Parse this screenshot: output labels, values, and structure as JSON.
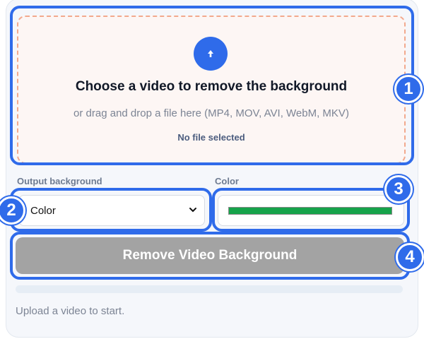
{
  "upload": {
    "icon": "upload-arrow-icon",
    "title": "Choose a video to remove the background",
    "subtitle": "or drag and drop a file here (MP4, MOV, AVI, WebM, MKV)",
    "status": "No file selected"
  },
  "output": {
    "label": "Output background",
    "selected": "Color"
  },
  "color": {
    "label": "Color",
    "value": "#16a34a"
  },
  "action": {
    "label": "Remove Video Background"
  },
  "progress": {
    "value": 0
  },
  "status_text": "Upload a video to start.",
  "badges": [
    "1",
    "2",
    "3",
    "4"
  ],
  "colors": {
    "accent": "#2f6bea",
    "button_disabled": "#a3a3a3",
    "dropzone_border": "#f2a98d"
  }
}
